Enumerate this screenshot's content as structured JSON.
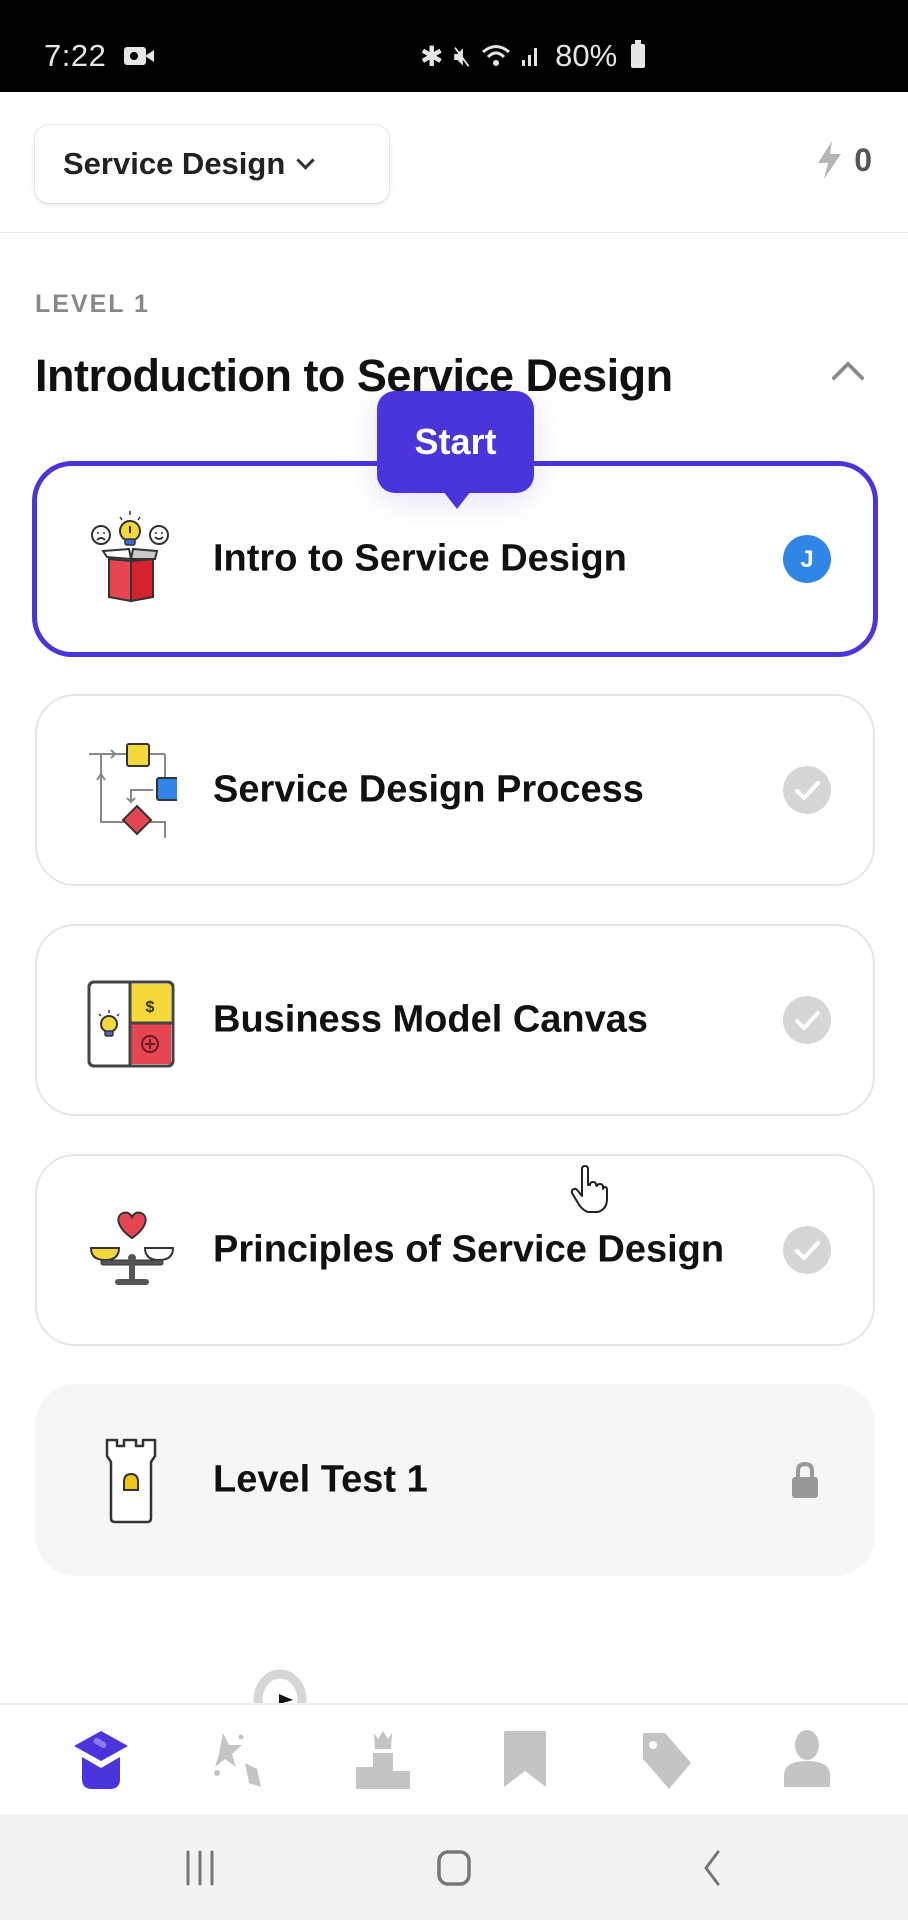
{
  "status_bar": {
    "time": "7:22",
    "battery": "80%",
    "icons": [
      "screen-record-icon",
      "bluetooth-icon",
      "mute-icon",
      "wifi-icon",
      "signal-icon",
      "battery-icon"
    ]
  },
  "header": {
    "course_selector": "Service Design",
    "energy_count": "0"
  },
  "level": {
    "label": "LEVEL 1",
    "title": "Introduction to Service Design",
    "expanded": true
  },
  "tooltip": {
    "label": "Start"
  },
  "lessons": [
    {
      "title": "Intro to Service Design",
      "status": "current",
      "badge": "J",
      "icon": "open-box-idea-icon"
    },
    {
      "title": "Service Design Process",
      "status": "not-completed",
      "icon": "process-flow-icon"
    },
    {
      "title": "Business Model Canvas",
      "status": "not-completed",
      "icon": "business-canvas-icon"
    },
    {
      "title": "Principles of Service Design",
      "status": "not-completed",
      "icon": "balance-scale-heart-icon"
    },
    {
      "title": "Level Test 1",
      "status": "locked",
      "icon": "castle-tower-icon"
    }
  ],
  "bottom_nav": [
    {
      "name": "learn",
      "icon": "graduation-cap-icon",
      "active": true
    },
    {
      "name": "practice",
      "icon": "stars-icon",
      "active": false
    },
    {
      "name": "leaderboard",
      "icon": "podium-icon",
      "active": false
    },
    {
      "name": "saved",
      "icon": "bookmark-icon",
      "active": false
    },
    {
      "name": "offers",
      "icon": "tag-icon",
      "active": false
    },
    {
      "name": "profile",
      "icon": "user-icon",
      "active": false
    }
  ],
  "colors": {
    "accent": "#4a34dc",
    "badge_blue": "#2f86e6",
    "muted_gray": "#c4c4c4"
  }
}
